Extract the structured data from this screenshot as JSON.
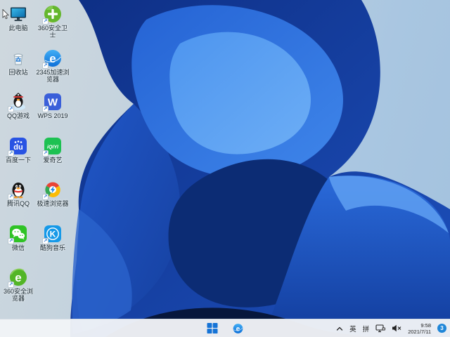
{
  "desktop": {
    "icons": [
      {
        "label": "此电脑",
        "shortcut": false
      },
      {
        "label": "360安全卫士",
        "shortcut": true
      },
      {
        "label": "回收站",
        "shortcut": false
      },
      {
        "label": "2345加速浏览器",
        "shortcut": true
      },
      {
        "label": "QQ游戏",
        "shortcut": true
      },
      {
        "label": "WPS 2019",
        "shortcut": true
      },
      {
        "label": "百度一下",
        "shortcut": true
      },
      {
        "label": "爱奇艺",
        "shortcut": true
      },
      {
        "label": "腾讯QQ",
        "shortcut": true
      },
      {
        "label": "极速浏览器",
        "shortcut": true
      },
      {
        "label": "微信",
        "shortcut": true
      },
      {
        "label": "酷狗音乐",
        "shortcut": true
      },
      {
        "label": "360安全浏览器",
        "shortcut": true
      }
    ]
  },
  "icon_glyphs": {
    "e_2345": "e",
    "wps": "W",
    "baidu": "du",
    "iqiyi": "iQIYI",
    "kugou": "K",
    "e_360": "e",
    "e_taskbar": "e"
  },
  "taskbar": {
    "language_english": "英",
    "language_pinyin": "拼",
    "clock": {
      "time": "9:58",
      "date": "2021/7/11"
    },
    "notification_badge": "3"
  },
  "colors": {
    "taskbar_bg": "#f0f3f6",
    "accent_blue": "#1573d6",
    "wallpaper_bg_left": "#cfd8de",
    "wallpaper_bg_right": "#a8c5e0",
    "bloom_dark": "#0e2f85",
    "bloom_bright": "#5fa4f4",
    "badge_bg": "#1f86d8"
  }
}
